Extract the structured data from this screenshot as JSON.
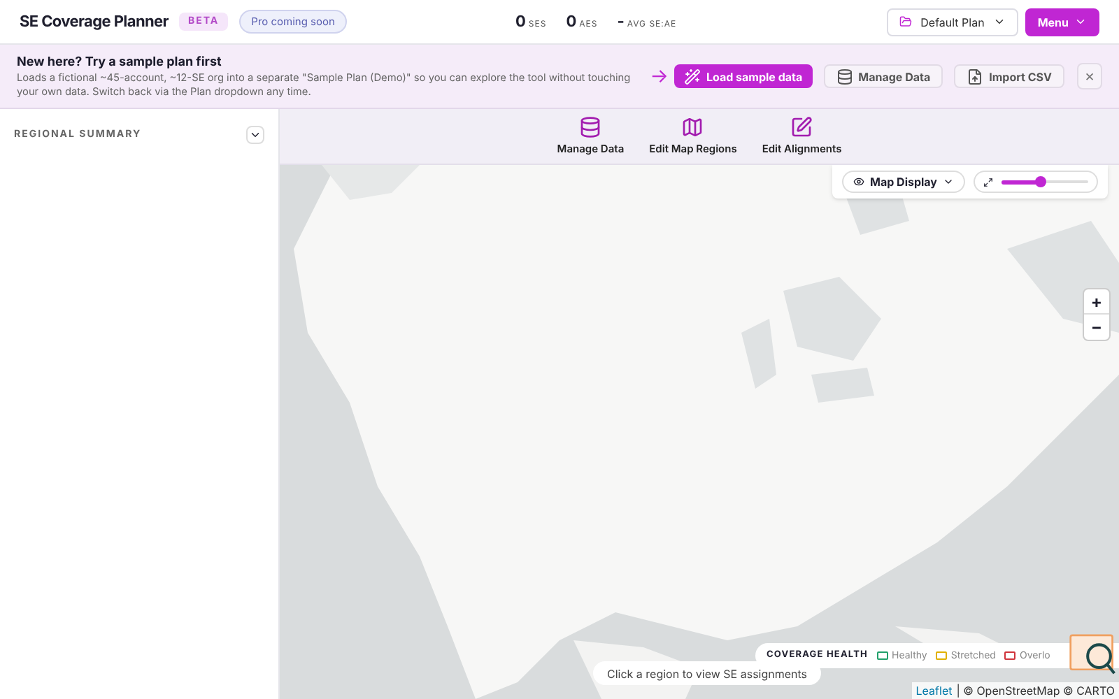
{
  "header": {
    "title": "SE Coverage Planner",
    "badge": "BETA",
    "pill": "Pro coming soon",
    "stats": [
      {
        "value": "0",
        "label": "SES"
      },
      {
        "value": "0",
        "label": "AES"
      },
      {
        "value": "-",
        "label": "AVG SE:AE"
      }
    ],
    "plan_button": "Default Plan",
    "menu_button": "Menu"
  },
  "banner": {
    "title": "New here? Try a sample plan first",
    "text": "Loads a fictional ~45-account, ~12-SE org into a separate \"Sample Plan (Demo)\" so you can explore the tool without touching your own data. Switch back via the Plan dropdown any time.",
    "arrow": "→",
    "buttons": [
      {
        "label": "Load sample data",
        "kind": "primary"
      },
      {
        "label": "Manage Data",
        "kind": "database"
      },
      {
        "label": "Import CSV",
        "kind": "import"
      }
    ],
    "close": "×"
  },
  "sidebar": {
    "title": "REGIONAL SUMMARY",
    "expanded": false
  },
  "toolbar": [
    {
      "label": "Manage Data",
      "kind": "database"
    },
    {
      "label": "Edit Map Regions",
      "kind": "map"
    },
    {
      "label": "Edit Alignments",
      "kind": "edit"
    }
  ],
  "map": {
    "kind": "picture",
    "display_button": "Map Display",
    "zoom": {
      "level": 0.45
    },
    "zoom_in": "+",
    "zoom_out": "−",
    "hint": "Click a region to view SE assignments",
    "legend": {
      "title": "COVERAGE HEALTH",
      "items": [
        {
          "label": "Healthy",
          "color": "#22a06b"
        },
        {
          "label": "Stretched",
          "color": "#e0b000"
        },
        {
          "label": "Overlo",
          "color": "#d0343c"
        }
      ]
    },
    "attribution": {
      "link": "Leaflet",
      "text": "| © OpenStreetMap © CARTO"
    }
  }
}
